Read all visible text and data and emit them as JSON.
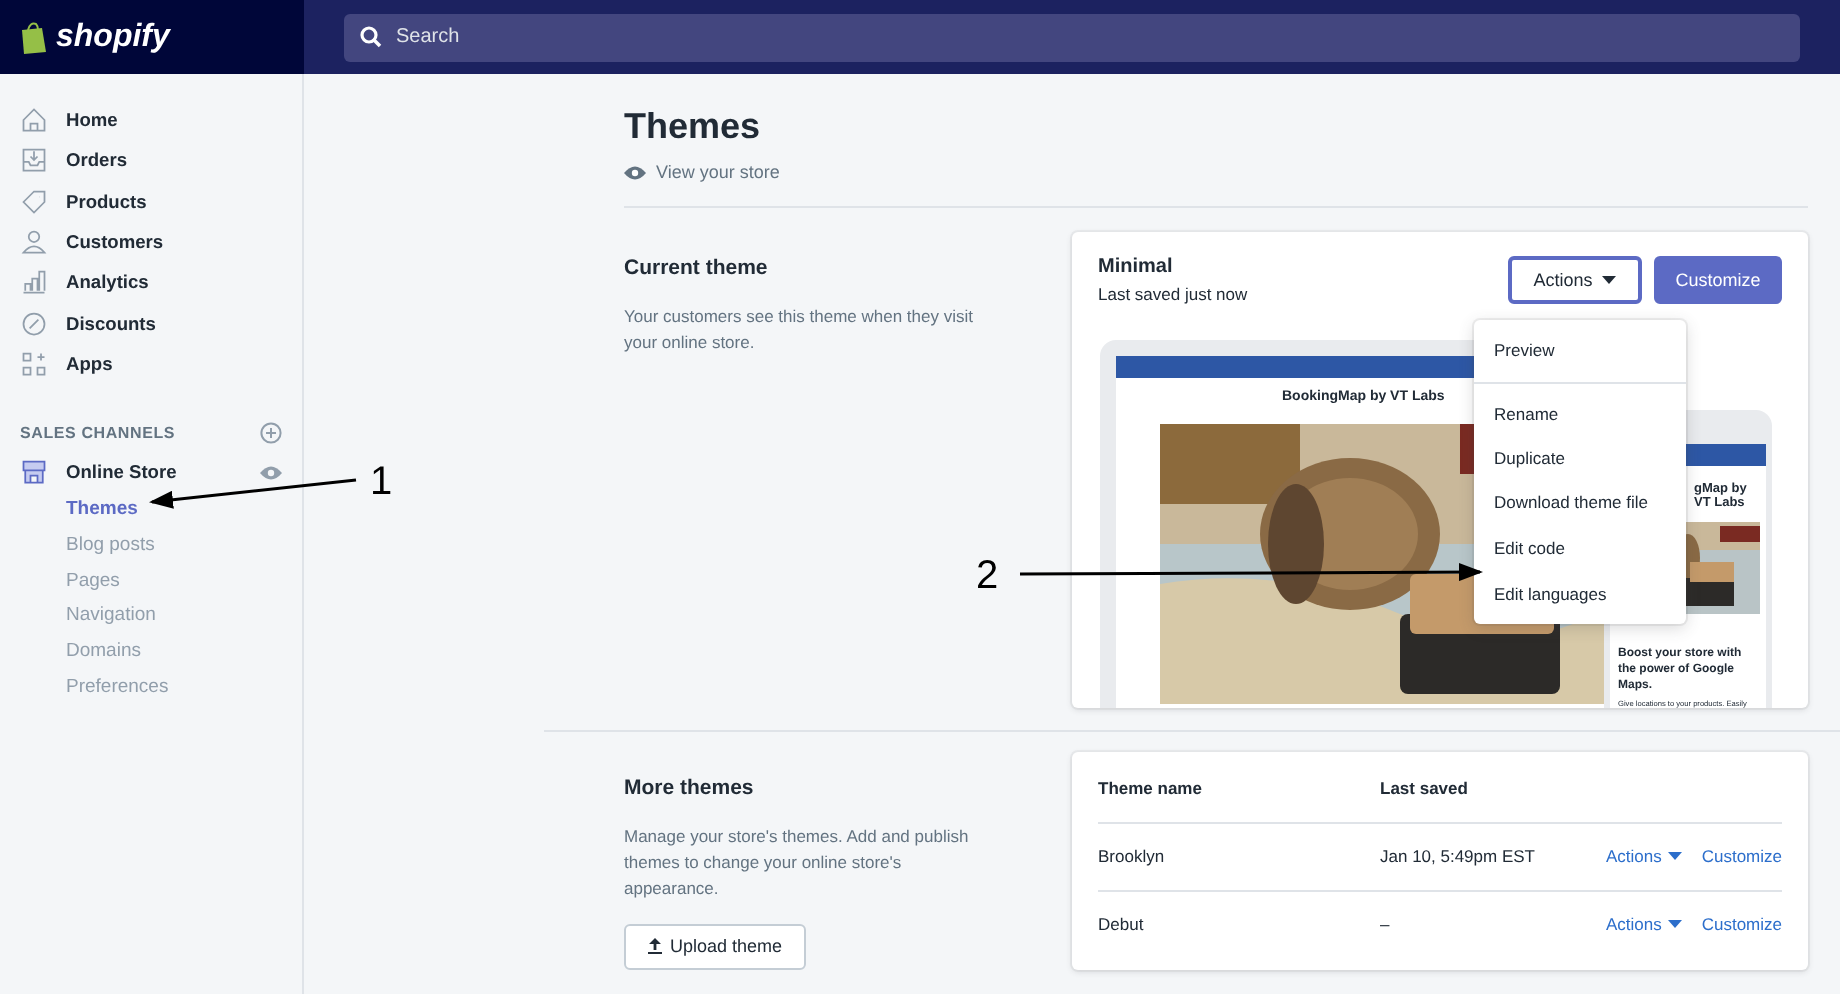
{
  "topbar": {
    "logo": "shopify",
    "search": {
      "placeholder": "Search"
    }
  },
  "sidebar": {
    "items": [
      {
        "label": "Home"
      },
      {
        "label": "Orders"
      },
      {
        "label": "Products"
      },
      {
        "label": "Customers"
      },
      {
        "label": "Analytics"
      },
      {
        "label": "Discounts"
      },
      {
        "label": "Apps"
      }
    ],
    "section_title": "SALES CHANNELS",
    "channel": {
      "label": "Online Store",
      "children": [
        {
          "label": "Themes",
          "selected": true
        },
        {
          "label": "Blog posts",
          "selected": false
        },
        {
          "label": "Pages",
          "selected": false
        },
        {
          "label": "Navigation",
          "selected": false
        },
        {
          "label": "Domains",
          "selected": false
        },
        {
          "label": "Preferences",
          "selected": false
        }
      ]
    }
  },
  "page": {
    "title": "Themes",
    "view_link": "View your store"
  },
  "current_theme": {
    "heading": "Current theme",
    "description": "Your customers see this theme when they visit your online store.",
    "name": "Minimal",
    "saved": "Last saved just now",
    "actions_button": "Actions",
    "customize_button": "Customize",
    "preview": {
      "desktop_title": "BookingMap by VT Labs",
      "mobile_title": "gMap by VT Labs",
      "mobile_heading": "Boost your store with the power of Google Maps.",
      "mobile_text": "Give locations to your products. Easily"
    },
    "menu": [
      {
        "label": "Preview"
      },
      {
        "label": "Rename"
      },
      {
        "label": "Duplicate"
      },
      {
        "label": "Download theme file"
      },
      {
        "label": "Edit code"
      },
      {
        "label": "Edit languages"
      }
    ]
  },
  "more_themes": {
    "heading": "More themes",
    "description": "Manage your store's themes. Add and publish themes to change your online store's appearance.",
    "upload_button": "Upload theme",
    "table": {
      "columns": [
        "Theme name",
        "Last saved"
      ],
      "rows": [
        {
          "name": "Brooklyn",
          "saved": "Jan 10, 5:49pm EST",
          "actions": "Actions",
          "customize": "Customize"
        },
        {
          "name": "Debut",
          "saved": "–",
          "actions": "Actions",
          "customize": "Customize"
        }
      ]
    }
  },
  "annotations": [
    {
      "label": "1"
    },
    {
      "label": "2"
    }
  ]
}
